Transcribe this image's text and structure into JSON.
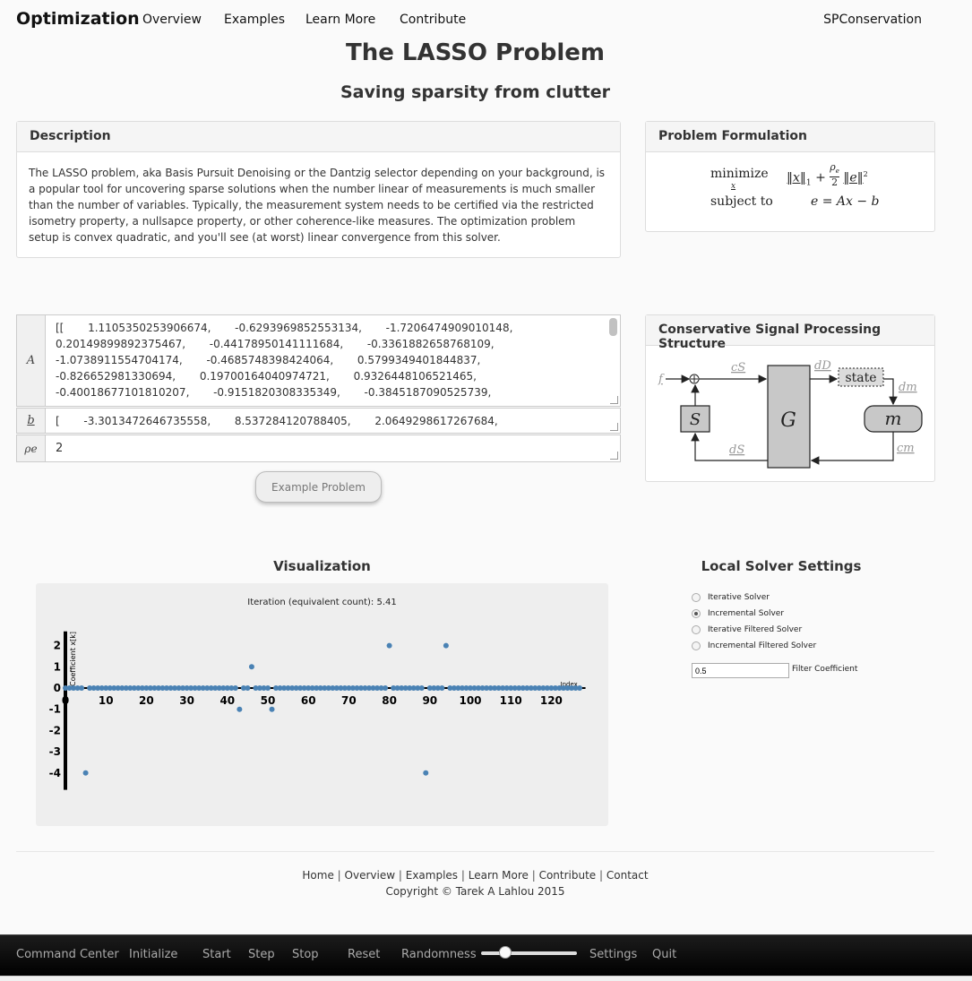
{
  "nav": {
    "brand": "Optimization",
    "links": [
      "Overview",
      "Examples",
      "Learn More",
      "Contribute"
    ],
    "right": "SPConservation"
  },
  "page": {
    "title": "The LASSO Problem",
    "subtitle": "Saving sparsity from clutter"
  },
  "description": {
    "heading": "Description",
    "text": "The LASSO problem, aka Basis Pursuit Denoising or the Dantzig selector depending on your background, is a popular tool for uncovering sparse solutions when the number linear of measurements is much smaller than the number of variables. Typically, the measurement system needs to be certified via the restricted isometry property, a nullsapce property, or other coherence-like measures. The optimization problem setup is convex quadratic, and you'll see (at worst) linear convergence from this solver."
  },
  "formulation": {
    "heading": "Problem Formulation",
    "minimize": "minimize",
    "min_var": "x",
    "subject_to": "subject to",
    "objective_a": "‖x‖",
    "sub_1": "1",
    "plus": "+",
    "rho": "ρ",
    "rho_sub": "e",
    "two": "2",
    "objective_b": "‖e‖",
    "sup_2": "2",
    "constraint": "e = Ax − b"
  },
  "inputs": {
    "A": {
      "label": "A",
      "value": "[[       1.1105350253906674,       -0.6293969852553134,       -1.7206474909010148,\n0.20149899892375467,       -0.44178950141111684,       -0.3361882658768109,\n-1.0738911554704174,       -0.4685748398424064,       0.5799349401844837,\n-0.826652981330694,       0.19700164040974721,       0.9326448106521465,\n-0.40018677101810207,       -0.9151820308335349,       -0.3845187090525739,"
    },
    "b": {
      "label": "b",
      "value": "[       -3.3013472646735558,       8.537284120788405,       2.0649298617267684,"
    },
    "rho": {
      "label": "ρe",
      "value": "2"
    }
  },
  "example_button": "Example Problem",
  "structure": {
    "heading": "Conservative Signal Processing Structure",
    "labels": {
      "f": "f",
      "cs": "cS",
      "dd": "dD",
      "state": "state",
      "dm": "dm",
      "S": "S",
      "G": "G",
      "m": "m",
      "ds": "dS",
      "cm": "cm"
    }
  },
  "visualization": {
    "heading": "Visualization",
    "iteration_label": "Iteration (equivalent count): 5.41"
  },
  "chart_data": {
    "type": "scatter",
    "title": "",
    "xlabel": "Index",
    "ylabel": "Coefficient x[k]",
    "xlim": [
      0,
      128
    ],
    "ylim": [
      -4.5,
      2.5
    ],
    "xticks": [
      0,
      10,
      20,
      30,
      40,
      50,
      60,
      70,
      80,
      90,
      100,
      110,
      120
    ],
    "yticks": [
      2,
      1,
      0,
      -1,
      -2,
      -3,
      -4
    ],
    "nonzero_points": [
      {
        "x": 5,
        "y": -4
      },
      {
        "x": 43,
        "y": -1
      },
      {
        "x": 46,
        "y": 1
      },
      {
        "x": 51,
        "y": -1
      },
      {
        "x": 80,
        "y": 2
      },
      {
        "x": 89,
        "y": -4
      },
      {
        "x": 94,
        "y": 2
      }
    ],
    "n_coefficients": 128,
    "point_color": "#4a82b4"
  },
  "settings": {
    "heading": "Local Solver Settings",
    "options": [
      {
        "label": "Iterative Solver",
        "selected": false
      },
      {
        "label": "Incremental Solver",
        "selected": true
      },
      {
        "label": "Iterative Filtered Solver",
        "selected": false
      },
      {
        "label": "Incremental Filtered Solver",
        "selected": false
      }
    ],
    "filter_value": "0.5",
    "filter_label": "Filter Coefficient"
  },
  "footer": {
    "links": [
      "Home",
      "Overview",
      "Examples",
      "Learn More",
      "Contribute",
      "Contact"
    ],
    "separator": "|",
    "copyright": "Copyright © Tarek A Lahlou 2015"
  },
  "command_bar": {
    "title": "Command Center",
    "initialize": "Initialize",
    "start": "Start",
    "step": "Step",
    "stop": "Stop",
    "reset": "Reset",
    "randomness": "Randomness",
    "randomness_level": 0.25,
    "settings": "Settings",
    "quit": "Quit"
  }
}
